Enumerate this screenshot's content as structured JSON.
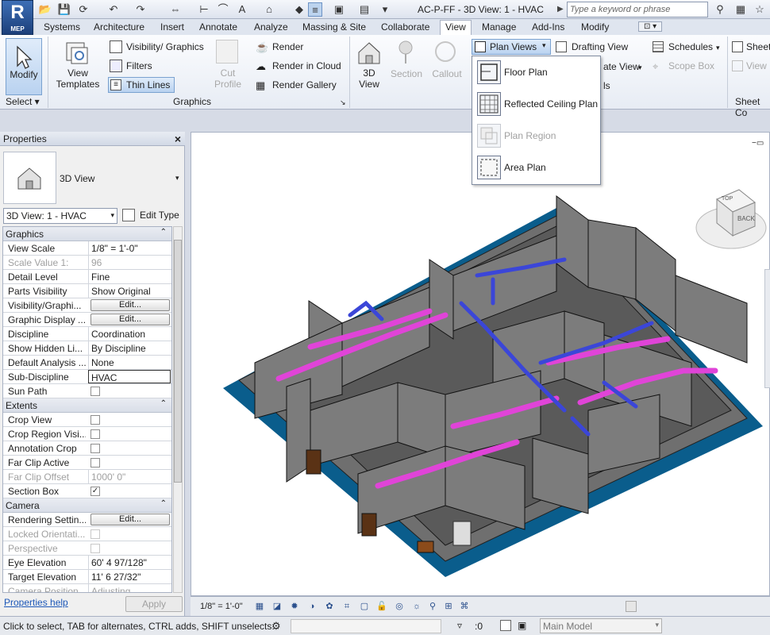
{
  "app": {
    "logo_text": "R",
    "logo_sub": "MEP",
    "title": "AC-P-FF - 3D View: 1 - HVAC",
    "search_placeholder": "Type a keyword or phrase"
  },
  "menu_tabs": [
    "Systems",
    "Architecture",
    "Insert",
    "Annotate",
    "Analyze",
    "Massing & Site",
    "Collaborate",
    "View",
    "Manage",
    "Add-Ins",
    "Modify"
  ],
  "active_tab": "View",
  "ribbon": {
    "modify": "Modify",
    "select_group": "Select ▾",
    "view_templates": "View Templates",
    "visibility_graphics": "Visibility/ Graphics",
    "filters": "Filters",
    "thin_lines": "Thin Lines",
    "cut_profile": "Cut Profile",
    "render": "Render",
    "render_cloud": "Render  in Cloud",
    "render_gallery": "Render  Gallery",
    "graphics_group": "Graphics",
    "view_3d": "3D View",
    "section": "Section",
    "callout": "Callout",
    "plan_views": "Plan Views",
    "drafting_view": "Drafting  View",
    "duplicate_view": "ate View",
    "legends": "ls",
    "schedules": "Schedules",
    "scope_box": "Scope  Box",
    "sheet": "Sheet",
    "view_small": "View",
    "sheet_comp_group": "Sheet Co"
  },
  "plan_views_menu": [
    {
      "label": "Floor Plan",
      "enabled": true
    },
    {
      "label": "Reflected Ceiling Plan",
      "enabled": true
    },
    {
      "label": "Plan Region",
      "enabled": false
    },
    {
      "label": "Area Plan",
      "enabled": true
    }
  ],
  "properties": {
    "header": "Properties",
    "type_name": "3D View",
    "instance_selector": "3D View: 1 - HVAC",
    "edit_type": "Edit Type",
    "sections": {
      "graphics": "Graphics",
      "extents": "Extents",
      "camera": "Camera"
    },
    "rows": {
      "view_scale": {
        "k": "View Scale",
        "v": "1/8\" = 1'-0\""
      },
      "scale_value": {
        "k": "Scale Value    1:",
        "v": "96"
      },
      "detail_level": {
        "k": "Detail Level",
        "v": "Fine"
      },
      "parts_visibility": {
        "k": "Parts Visibility",
        "v": "Show Original"
      },
      "visibility_graphics": {
        "k": "Visibility/Graphi...",
        "v": "Edit..."
      },
      "graphic_display": {
        "k": "Graphic Display ...",
        "v": "Edit..."
      },
      "discipline": {
        "k": "Discipline",
        "v": "Coordination"
      },
      "show_hidden": {
        "k": "Show Hidden Li...",
        "v": "By Discipline"
      },
      "default_analysis": {
        "k": "Default Analysis ...",
        "v": "None"
      },
      "sub_discipline": {
        "k": "Sub-Discipline",
        "v": "HVAC"
      },
      "sun_path": {
        "k": "Sun Path",
        "v": ""
      },
      "crop_view": {
        "k": "Crop View",
        "v": ""
      },
      "crop_region": {
        "k": "Crop Region Visi...",
        "v": ""
      },
      "annotation_crop": {
        "k": "Annotation Crop",
        "v": ""
      },
      "far_clip_active": {
        "k": "Far Clip Active",
        "v": ""
      },
      "far_clip_offset": {
        "k": "Far Clip Offset",
        "v": "1000'  0\""
      },
      "section_box": {
        "k": "Section Box",
        "v": "✓"
      },
      "rendering_settings": {
        "k": "Rendering Settin...",
        "v": "Edit..."
      },
      "locked_orientation": {
        "k": "Locked Orientati...",
        "v": ""
      },
      "perspective": {
        "k": "Perspective",
        "v": ""
      },
      "eye_elevation": {
        "k": "Eye Elevation",
        "v": "60'  4 97/128\""
      },
      "target_elevation": {
        "k": "Target Elevation",
        "v": "11'  6 27/32\""
      },
      "camera_position": {
        "k": "Camera Position",
        "v": "Adjusting"
      }
    },
    "help_link": "Properties help",
    "apply": "Apply"
  },
  "viewcube": {
    "face_top": "TOP",
    "face_back": "BACK"
  },
  "view_control_bar": {
    "scale": "1/8\" = 1'-0\""
  },
  "status": {
    "text": "Click to select, TAB for alternates, CTRL adds, SHIFT unselects.",
    "selection_count": ":0",
    "model": "Main Model"
  }
}
